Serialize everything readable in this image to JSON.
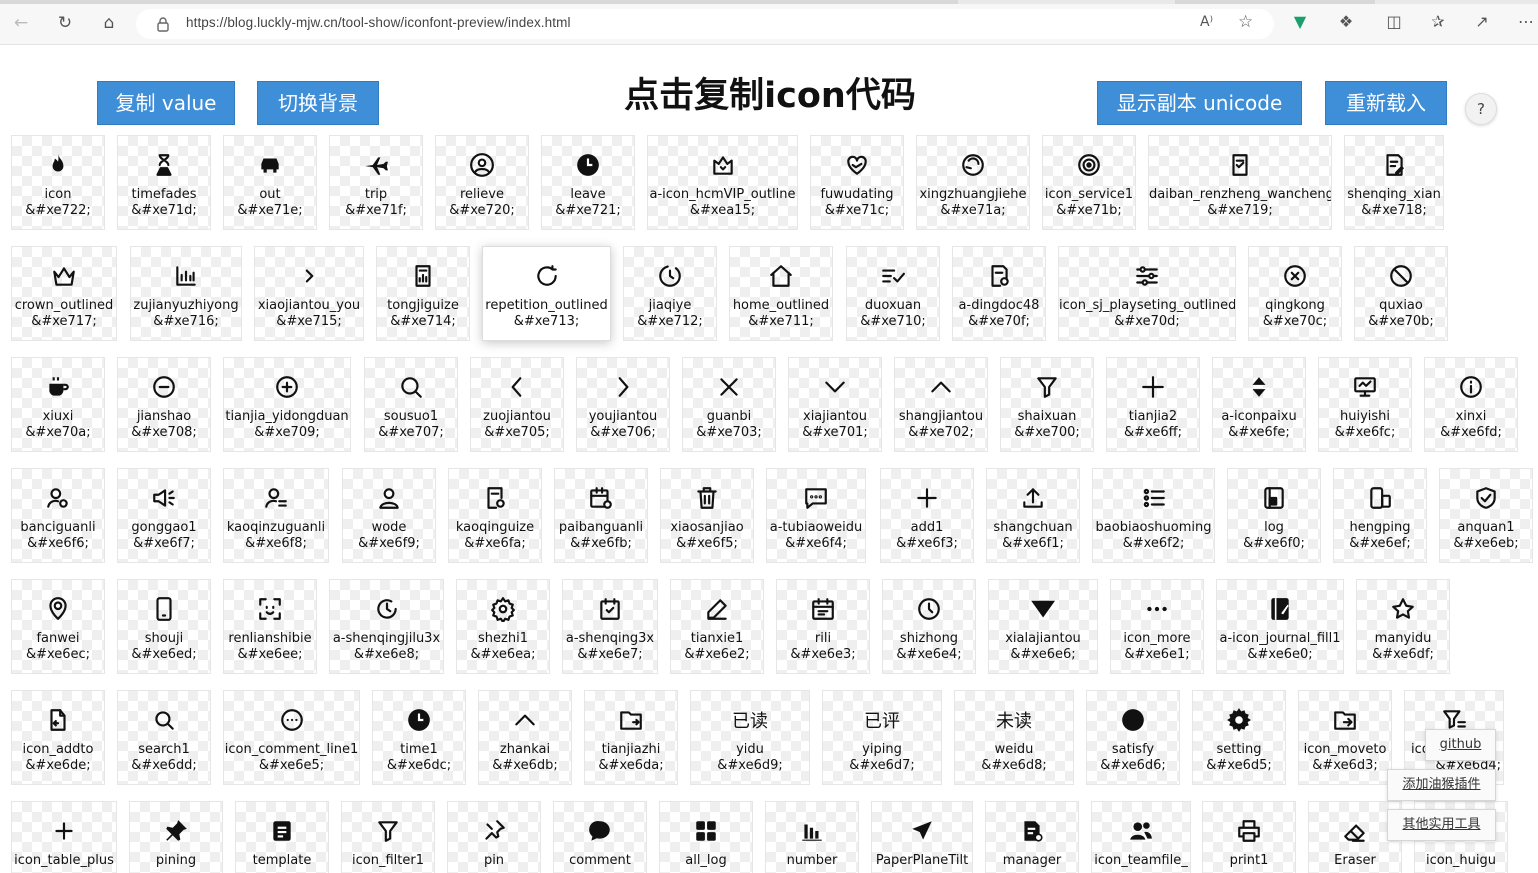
{
  "browser": {
    "url": "https://blog.luckly-mjw.cn/tool-show/iconfont-preview/index.html",
    "read_aloud": "A⁾",
    "icons": [
      "back-icon",
      "refresh-icon",
      "home-icon",
      "lock-icon",
      "favorite-icon",
      "extensions-icon",
      "split-screen-icon",
      "favorites-icon",
      "share-icon",
      "more-icon"
    ]
  },
  "header": {
    "copy_value": "复制 value",
    "switch_bg": "切换背景",
    "title": "点击复制icon代码",
    "show_unicode": "显示副本 unicode",
    "reload": "重新载入",
    "help": "?"
  },
  "icons": [
    {
      "name": "icon",
      "code": "&#xe722;"
    },
    {
      "name": "timefades",
      "code": "&#xe71d;"
    },
    {
      "name": "out",
      "code": "&#xe71e;"
    },
    {
      "name": "trip",
      "code": "&#xe71f;"
    },
    {
      "name": "relieve",
      "code": "&#xe720;"
    },
    {
      "name": "leave",
      "code": "&#xe721;"
    },
    {
      "name": "a-icon_hcmVIP_outline",
      "code": "&#xea15;"
    },
    {
      "name": "fuwudating",
      "code": "&#xe71c;"
    },
    {
      "name": "xingzhuangjiehe",
      "code": "&#xe71a;"
    },
    {
      "name": "icon_service1",
      "code": "&#xe71b;"
    },
    {
      "name": "daiban_renzheng_wancheng",
      "code": "&#xe719;"
    },
    {
      "name": "shenqing_xian",
      "code": "&#xe718;"
    },
    {
      "name": "crown_outlined",
      "code": "&#xe717;"
    },
    {
      "name": "zujianyuzhiyong",
      "code": "&#xe716;"
    },
    {
      "name": "xiaojiantou_you",
      "code": "&#xe715;"
    },
    {
      "name": "tongjiguize",
      "code": "&#xe714;"
    },
    {
      "name": "repetition_outlined",
      "code": "&#xe713;"
    },
    {
      "name": "jiaqiye",
      "code": "&#xe712;"
    },
    {
      "name": "home_outlined",
      "code": "&#xe711;"
    },
    {
      "name": "duoxuan",
      "code": "&#xe710;"
    },
    {
      "name": "a-dingdoc48",
      "code": "&#xe70f;"
    },
    {
      "name": "icon_sj_playseting_outlined",
      "code": "&#xe70d;"
    },
    {
      "name": "qingkong",
      "code": "&#xe70c;"
    },
    {
      "name": "quxiao",
      "code": "&#xe70b;"
    },
    {
      "name": "xiuxi",
      "code": "&#xe70a;"
    },
    {
      "name": "jianshao",
      "code": "&#xe708;"
    },
    {
      "name": "tianjia_yidongduan",
      "code": "&#xe709;"
    },
    {
      "name": "sousuo1",
      "code": "&#xe707;"
    },
    {
      "name": "zuojiantou",
      "code": "&#xe705;"
    },
    {
      "name": "youjiantou",
      "code": "&#xe706;"
    },
    {
      "name": "guanbi",
      "code": "&#xe703;"
    },
    {
      "name": "xiajiantou",
      "code": "&#xe701;"
    },
    {
      "name": "shangjiantou",
      "code": "&#xe702;"
    },
    {
      "name": "shaixuan",
      "code": "&#xe700;"
    },
    {
      "name": "tianjia2",
      "code": "&#xe6ff;"
    },
    {
      "name": "a-iconpaixu",
      "code": "&#xe6fe;"
    },
    {
      "name": "huiyishi",
      "code": "&#xe6fc;"
    },
    {
      "name": "xinxi",
      "code": "&#xe6fd;"
    },
    {
      "name": "banciguanli",
      "code": "&#xe6f6;"
    },
    {
      "name": "gonggao1",
      "code": "&#xe6f7;"
    },
    {
      "name": "kaoqinzuguanli",
      "code": "&#xe6f8;"
    },
    {
      "name": "wode",
      "code": "&#xe6f9;"
    },
    {
      "name": "kaoqinguize",
      "code": "&#xe6fa;"
    },
    {
      "name": "paibanguanli",
      "code": "&#xe6fb;"
    },
    {
      "name": "xiaosanjiao",
      "code": "&#xe6f5;"
    },
    {
      "name": "a-tubiaoweidu",
      "code": "&#xe6f4;"
    },
    {
      "name": "add1",
      "code": "&#xe6f3;"
    },
    {
      "name": "shangchuan",
      "code": "&#xe6f1;"
    },
    {
      "name": "baobiaoshuoming",
      "code": "&#xe6f2;"
    },
    {
      "name": "log",
      "code": "&#xe6f0;"
    },
    {
      "name": "hengping",
      "code": "&#xe6ef;"
    },
    {
      "name": "anquan1",
      "code": "&#xe6eb;"
    },
    {
      "name": "fanwei",
      "code": "&#xe6ec;"
    },
    {
      "name": "shouji",
      "code": "&#xe6ed;"
    },
    {
      "name": "renlianshibie",
      "code": "&#xe6ee;"
    },
    {
      "name": "a-shenqingjilu3x",
      "code": "&#xe6e8;"
    },
    {
      "name": "shezhi1",
      "code": "&#xe6ea;"
    },
    {
      "name": "a-shenqing3x",
      "code": "&#xe6e7;"
    },
    {
      "name": "tianxie1",
      "code": "&#xe6e2;"
    },
    {
      "name": "rili",
      "code": "&#xe6e3;"
    },
    {
      "name": "shizhong",
      "code": "&#xe6e4;"
    },
    {
      "name": "xialajiantou",
      "code": "&#xe6e6;"
    },
    {
      "name": "icon_more",
      "code": "&#xe6e1;"
    },
    {
      "name": "a-icon_journal_fill1",
      "code": "&#xe6e0;"
    },
    {
      "name": "manyidu",
      "code": "&#xe6df;"
    },
    {
      "name": "icon_addto",
      "code": "&#xe6de;"
    },
    {
      "name": "search1",
      "code": "&#xe6dd;"
    },
    {
      "name": "icon_comment_line1",
      "code": "&#xe6e5;"
    },
    {
      "name": "time1",
      "code": "&#xe6dc;"
    },
    {
      "name": "zhankai",
      "code": "&#xe6db;"
    },
    {
      "name": "tianjiazhi",
      "code": "&#xe6da;"
    },
    {
      "name": "yidu",
      "code": "&#xe6d9;",
      "glyph_text": "已读"
    },
    {
      "name": "yiping",
      "code": "&#xe6d7;",
      "glyph_text": "已评"
    },
    {
      "name": "weidu",
      "code": "&#xe6d8;",
      "glyph_text": "未读"
    },
    {
      "name": "satisfy",
      "code": "&#xe6d6;"
    },
    {
      "name": "setting",
      "code": "&#xe6d5;"
    },
    {
      "name": "icon_moveto",
      "code": "&#xe6d3;"
    },
    {
      "name": "icon_filter_partial",
      "code": "&#xe6d4;",
      "display_name": "ico",
      "display_code": "&#xe6d4;"
    },
    {
      "name": "icon_table_plus",
      "code": ""
    },
    {
      "name": "pining",
      "code": ""
    },
    {
      "name": "template",
      "code": ""
    },
    {
      "name": "icon_filter1",
      "code": ""
    },
    {
      "name": "pin",
      "code": ""
    },
    {
      "name": "comment",
      "code": ""
    },
    {
      "name": "all_log",
      "code": ""
    },
    {
      "name": "number",
      "code": ""
    },
    {
      "name": "PaperPlaneTilt",
      "code": ""
    },
    {
      "name": "manager",
      "code": ""
    },
    {
      "name": "icon_teamfile_",
      "code": ""
    },
    {
      "name": "print1",
      "code": ""
    },
    {
      "name": "Eraser",
      "code": ""
    },
    {
      "name": "icon_huigu",
      "code": ""
    }
  ],
  "floating": {
    "github": "github",
    "add_plugin": "添加油猴插件",
    "other_tools": "其他实用工具"
  }
}
